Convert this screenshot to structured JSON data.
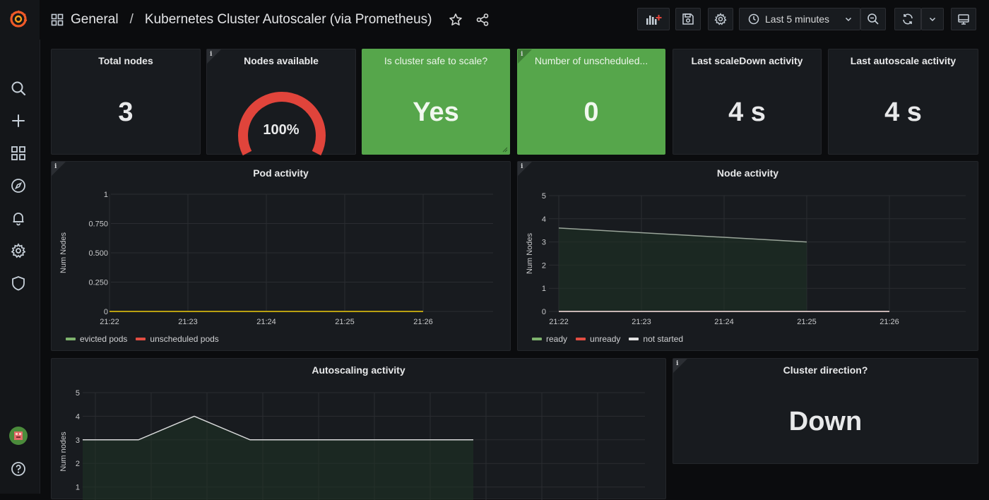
{
  "breadcrumb": {
    "folder": "General",
    "separator": "/",
    "dashboard": "Kubernetes Cluster Autoscaler (via Prometheus)"
  },
  "toolbar": {
    "time_range": "Last 5 minutes"
  },
  "icons": {
    "sidebar": [
      "grafana-logo-icon",
      "search-icon",
      "plus-icon",
      "dashboards-icon",
      "explore-compass-icon",
      "alerting-bell-icon",
      "configuration-gear-icon",
      "shield-icon",
      "user-avatar",
      "help-icon"
    ],
    "topbar": [
      "dashboard-grid-icon",
      "star-icon",
      "share-icon",
      "add-panel-icon",
      "save-icon",
      "settings-gear-icon",
      "clock-icon",
      "chevron-down-icon",
      "zoom-out-icon",
      "refresh-icon",
      "chevron-down-icon",
      "tv-mode-icon"
    ]
  },
  "colors": {
    "green": "#56a64b",
    "red": "#e0443b",
    "ready": "#7eb26d",
    "unready": "#e24d42",
    "not_started": "#e0e0e0"
  },
  "stats": {
    "total_nodes": {
      "title": "Total nodes",
      "value": "3"
    },
    "nodes_available": {
      "title": "Nodes available",
      "value": "100%",
      "percent": 100
    },
    "safe_to_scale": {
      "title": "Is cluster safe to scale?",
      "value": "Yes"
    },
    "unscheduled": {
      "title": "Number of unscheduled...",
      "value": "0"
    },
    "last_scaledown": {
      "title": "Last scaleDown activity",
      "value": "4 s"
    },
    "last_autoscale": {
      "title": "Last autoscale activity",
      "value": "4 s"
    }
  },
  "pod_activity": {
    "title": "Pod activity",
    "legend": [
      "evicted pods",
      "unscheduled pods"
    ],
    "chart_data": {
      "type": "line",
      "x": [
        "21:22",
        "21:23",
        "21:24",
        "21:25",
        "21:26"
      ],
      "ylabel": "Num Nodes",
      "yticks": [
        "0",
        "0.250",
        "0.500",
        "0.750",
        "1"
      ],
      "ylim": [
        0,
        1
      ],
      "series": [
        {
          "name": "evicted pods",
          "values": [
            0,
            0,
            0,
            0,
            0
          ]
        },
        {
          "name": "unscheduled pods",
          "values": [
            0,
            0,
            0,
            0,
            0
          ]
        }
      ]
    }
  },
  "node_activity": {
    "title": "Node activity",
    "legend": [
      "ready",
      "unready",
      "not started"
    ],
    "chart_data": {
      "type": "area",
      "x": [
        "21:22",
        "21:23",
        "21:24",
        "21:25",
        "21:26"
      ],
      "ylabel": "Num Nodes",
      "yticks": [
        "0",
        "1",
        "2",
        "3",
        "4",
        "5"
      ],
      "ylim": [
        0,
        5
      ],
      "series": [
        {
          "name": "ready",
          "values": [
            3.6,
            3.4,
            3.2,
            3.0
          ]
        },
        {
          "name": "unready",
          "values": [
            0,
            0,
            0,
            0,
            0
          ]
        },
        {
          "name": "not started",
          "values": [
            0,
            0,
            0,
            0,
            0
          ]
        }
      ]
    }
  },
  "autoscaling_activity": {
    "title": "Autoscaling activity",
    "chart_data": {
      "type": "area",
      "ylabel": "Num nodes",
      "yticks": [
        "1",
        "2",
        "3",
        "4",
        "5"
      ],
      "ylim": [
        0,
        5
      ],
      "series": [
        {
          "values": [
            3,
            3,
            4,
            3,
            3,
            3,
            3,
            3
          ]
        }
      ]
    }
  },
  "cluster_direction": {
    "title": "Cluster direction?",
    "value": "Down"
  }
}
